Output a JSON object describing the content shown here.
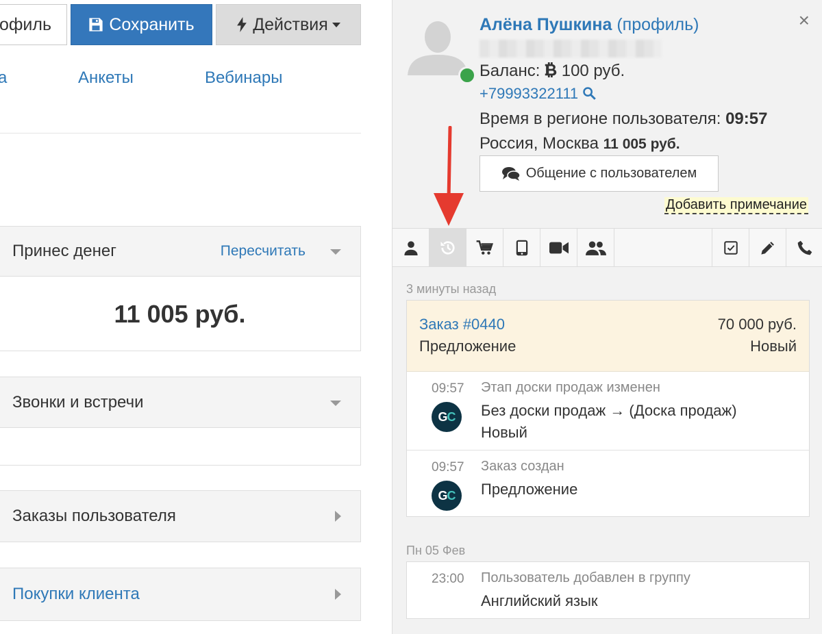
{
  "toolbar": {
    "profile_label": "офиль",
    "save_label": "Сохранить",
    "actions_label": "Действия"
  },
  "nav": {
    "items": [
      "а",
      "Анкеты",
      "Вебинары"
    ]
  },
  "panels": {
    "money": {
      "title": "Принес денег",
      "recalc_label": "Пересчитать",
      "value": "11 005 руб."
    },
    "calls": {
      "title": "Звонки и встречи"
    },
    "orders": {
      "title": "Заказы пользователя"
    },
    "purchases": {
      "title": "Покупки клиента"
    }
  },
  "user": {
    "name": "Алёна Пушкина",
    "profile_link": "(профиль)",
    "balance_label": "Баланс:",
    "balance_value": "100 руб.",
    "phone": "+79993322111",
    "time_label": "Время в регионе пользователя:",
    "time_value": "09:57",
    "region": "Россия, Москва",
    "region_amount": "11 005 руб.",
    "chat_button": "Общение с пользователем",
    "add_note": "Добавить примечание",
    "close_symbol": "×"
  },
  "timeline": {
    "groups": [
      {
        "day": "3 минуты назад",
        "order": {
          "link": "Заказ #0440",
          "amount": "70 000 руб.",
          "type": "Предложение",
          "status": "Новый"
        },
        "events": [
          {
            "time": "09:57",
            "title": "Этап доски продаж изменен",
            "line1": "Без доски продаж → (Доска продаж)",
            "line2": "Новый",
            "avatar": "GC"
          },
          {
            "time": "09:57",
            "title": "Заказ создан",
            "line1": "Предложение",
            "avatar": "GC"
          }
        ]
      },
      {
        "day": "Пн 05 Фев",
        "events": [
          {
            "time": "23:00",
            "title": "Пользователь добавлен в группу",
            "line1": "Английский язык"
          }
        ]
      }
    ]
  },
  "icons": {
    "tabs": [
      "user-icon",
      "history-icon",
      "cart-icon",
      "tablet-icon",
      "video-icon",
      "group-icon",
      "checkbox-icon",
      "pencil-icon",
      "phone-icon"
    ]
  },
  "colors": {
    "accent": "#2e78b7",
    "save_button": "#3477bb",
    "online": "#3ba34a",
    "arrow": "#e53a2f",
    "order_highlight": "#fcf3e0"
  }
}
